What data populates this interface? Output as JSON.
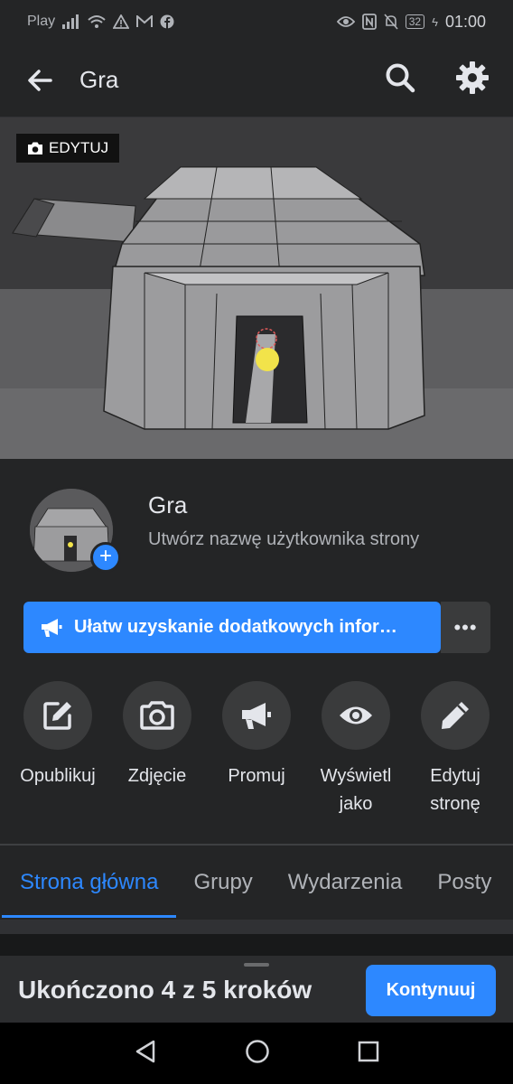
{
  "status_bar": {
    "carrier": "Play",
    "battery": "32",
    "time": "01:00"
  },
  "app_bar": {
    "title": "Gra",
    "back_icon": "arrow-left-icon",
    "search_icon": "search-icon",
    "settings_icon": "gear-icon"
  },
  "cover": {
    "edit_label": "EDYTUJ"
  },
  "profile": {
    "name": "Gra",
    "username_prompt": "Utwórz nazwę użytkownika strony"
  },
  "cta": {
    "label": "Ułatw uzyskanie dodatkowych infor…",
    "more_label": "•••"
  },
  "actions": [
    {
      "label": "Opublikuj",
      "icon": "compose-icon"
    },
    {
      "label": "Zdjęcie",
      "icon": "camera-icon"
    },
    {
      "label": "Promuj",
      "icon": "megaphone-icon"
    },
    {
      "label": "Wyświetl jako",
      "icon": "eye-icon"
    },
    {
      "label": "Edytuj stronę",
      "icon": "pencil-icon"
    }
  ],
  "tabs": [
    {
      "label": "Strona główna",
      "active": true
    },
    {
      "label": "Grupy",
      "active": false
    },
    {
      "label": "Wydarzenia",
      "active": false
    },
    {
      "label": "Posty",
      "active": false
    }
  ],
  "banner": {
    "text": "Ukończono 4 z 5 kroków",
    "button": "Kontynuuj"
  },
  "colors": {
    "accent": "#2d88ff",
    "background": "#18191a",
    "surface": "#242526"
  }
}
